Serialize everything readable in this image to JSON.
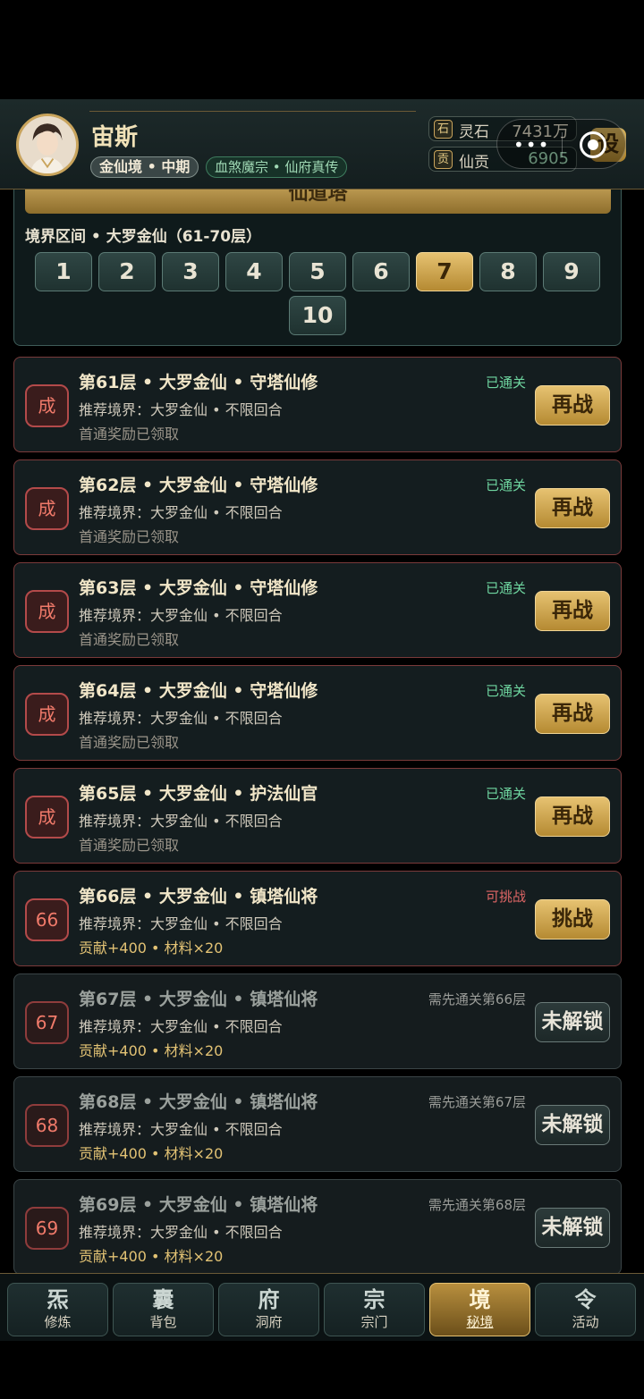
{
  "header": {
    "player_name": "宙斯",
    "realm": "金仙境 • 中期",
    "sect": "血煞魔宗 • 仙府真传",
    "resources": [
      {
        "icon": "石",
        "label": "灵石",
        "value": "7431万"
      },
      {
        "icon": "贡",
        "label": "仙贡",
        "value": "6905"
      }
    ],
    "settings_label": "设",
    "capsule_dots": "•••"
  },
  "tower": {
    "title": "仙道塔",
    "range_label": "境界区间 • 大罗金仙（61-70层）",
    "pages": [
      "1",
      "2",
      "3",
      "4",
      "5",
      "6",
      "7",
      "8",
      "9",
      "10"
    ],
    "active_page": "7"
  },
  "floors": [
    {
      "badge": "成",
      "title": "第61层 • 大罗金仙 • 守塔仙修",
      "sub": "推荐境界：大罗金仙 • 不限回合",
      "reward": "首通奖励已领取",
      "status": "已通关",
      "button": "再战"
    },
    {
      "badge": "成",
      "title": "第62层 • 大罗金仙 • 守塔仙修",
      "sub": "推荐境界：大罗金仙 • 不限回合",
      "reward": "首通奖励已领取",
      "status": "已通关",
      "button": "再战"
    },
    {
      "badge": "成",
      "title": "第63层 • 大罗金仙 • 守塔仙修",
      "sub": "推荐境界：大罗金仙 • 不限回合",
      "reward": "首通奖励已领取",
      "status": "已通关",
      "button": "再战"
    },
    {
      "badge": "成",
      "title": "第64层 • 大罗金仙 • 守塔仙修",
      "sub": "推荐境界：大罗金仙 • 不限回合",
      "reward": "首通奖励已领取",
      "status": "已通关",
      "button": "再战"
    },
    {
      "badge": "成",
      "title": "第65层 • 大罗金仙 • 护法仙官",
      "sub": "推荐境界：大罗金仙 • 不限回合",
      "reward": "首通奖励已领取",
      "status": "已通关",
      "button": "再战"
    },
    {
      "badge": "66",
      "title": "第66层 • 大罗金仙 • 镇塔仙将",
      "sub": "推荐境界：大罗金仙 • 不限回合",
      "reward": "贡献+400 • 材料×20",
      "status": "可挑战",
      "button": "挑战"
    },
    {
      "badge": "67",
      "title": "第67层 • 大罗金仙 • 镇塔仙将",
      "sub": "推荐境界：大罗金仙 • 不限回合",
      "reward": "贡献+400 • 材料×20",
      "status": "需先通关第66层",
      "button": "未解锁"
    },
    {
      "badge": "68",
      "title": "第68层 • 大罗金仙 • 镇塔仙将",
      "sub": "推荐境界：大罗金仙 • 不限回合",
      "reward": "贡献+400 • 材料×20",
      "status": "需先通关第67层",
      "button": "未解锁"
    },
    {
      "badge": "69",
      "title": "第69层 • 大罗金仙 • 镇塔仙将",
      "sub": "推荐境界：大罗金仙 • 不限回合",
      "reward": "贡献+400 • 材料×20",
      "status": "需先通关第68层",
      "button": "未解锁"
    }
  ],
  "nav": [
    {
      "icon": "炁",
      "label": "修炼"
    },
    {
      "icon": "囊",
      "label": "背包"
    },
    {
      "icon": "府",
      "label": "洞府"
    },
    {
      "icon": "宗",
      "label": "宗门"
    },
    {
      "icon": "境",
      "label": "秘境"
    },
    {
      "icon": "令",
      "label": "活动"
    }
  ],
  "nav_active": "秘境",
  "colors": {
    "accent_gold": "#e6c271",
    "cleared_green": "#6fd6a0",
    "challenge_red": "#e06666",
    "background": "#0f1a1b"
  }
}
